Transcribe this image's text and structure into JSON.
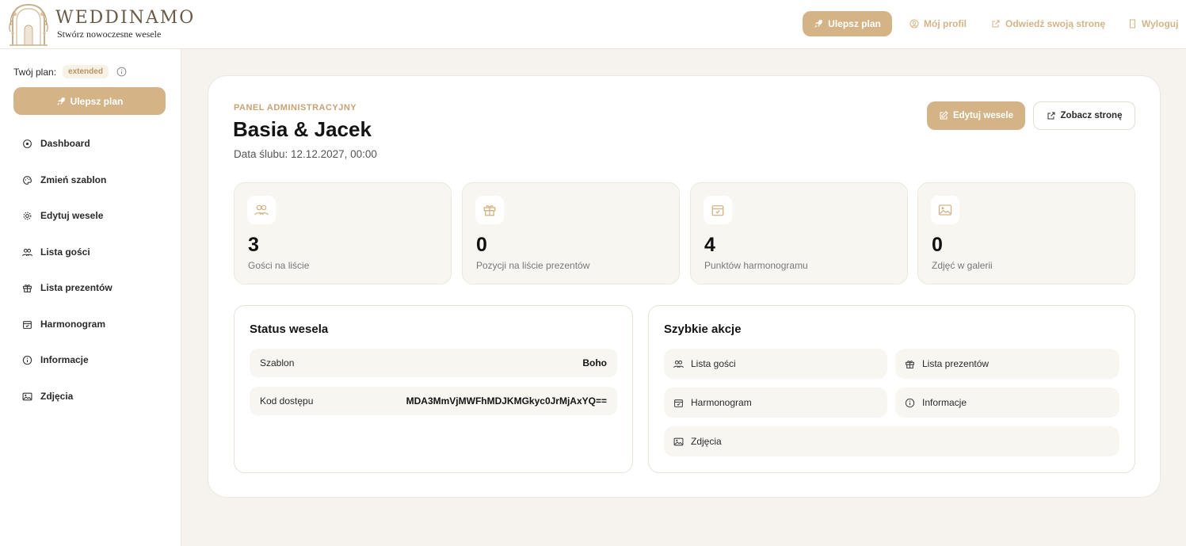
{
  "header": {
    "brand_name": "WEDDINAMO",
    "brand_tagline": "Stwórz nowoczesne wesele",
    "upgrade_label": "Ulepsz plan",
    "profile_label": "Mój profil",
    "visit_label": "Odwiedź swoją stronę",
    "logout_label": "Wyloguj"
  },
  "sidebar": {
    "plan_label": "Twój plan:",
    "plan_value": "extended",
    "upgrade_label": "Ulepsz plan",
    "items": [
      {
        "label": "Dashboard",
        "icon": "dashboard-icon"
      },
      {
        "label": "Zmień szablon",
        "icon": "palette-icon"
      },
      {
        "label": "Edytuj wesele",
        "icon": "gear-icon"
      },
      {
        "label": "Lista gości",
        "icon": "users-icon"
      },
      {
        "label": "Lista prezentów",
        "icon": "gift-icon"
      },
      {
        "label": "Harmonogram",
        "icon": "calendar-check-icon"
      },
      {
        "label": "Informacje",
        "icon": "info-icon"
      },
      {
        "label": "Zdjęcia",
        "icon": "image-icon"
      }
    ]
  },
  "main": {
    "eyebrow": "PANEL ADMINISTRACYJNY",
    "title": "Basia & Jacek",
    "date_text": "Data ślubu: 12.12.2027, 00:00",
    "edit_button": "Edytuj wesele",
    "view_button": "Zobacz stronę",
    "stats": [
      {
        "value": "3",
        "label": "Gości na liście",
        "icon": "users-icon"
      },
      {
        "value": "0",
        "label": "Pozycji na liście prezentów",
        "icon": "gift-icon"
      },
      {
        "value": "4",
        "label": "Punktów harmonogramu",
        "icon": "calendar-check-icon"
      },
      {
        "value": "0",
        "label": "Zdjęć w galerii",
        "icon": "image-icon"
      }
    ],
    "status": {
      "title": "Status wesela",
      "rows": [
        {
          "key": "Szablon",
          "value": "Boho"
        },
        {
          "key": "Kod dostępu",
          "value": "MDA3MmVjMWFhMDJKMGkyc0JrMjAxYQ=="
        }
      ]
    },
    "quick": {
      "title": "Szybkie akcje",
      "actions": [
        {
          "label": "Lista gości",
          "icon": "users-icon"
        },
        {
          "label": "Lista prezentów",
          "icon": "gift-icon"
        },
        {
          "label": "Harmonogram",
          "icon": "calendar-check-icon"
        },
        {
          "label": "Informacje",
          "icon": "info-icon"
        },
        {
          "label": "Zdjęcia",
          "icon": "image-icon"
        }
      ]
    }
  },
  "colors": {
    "accent": "#d4b486",
    "eyebrow": "#c7a273",
    "background": "#f6f3ee"
  }
}
